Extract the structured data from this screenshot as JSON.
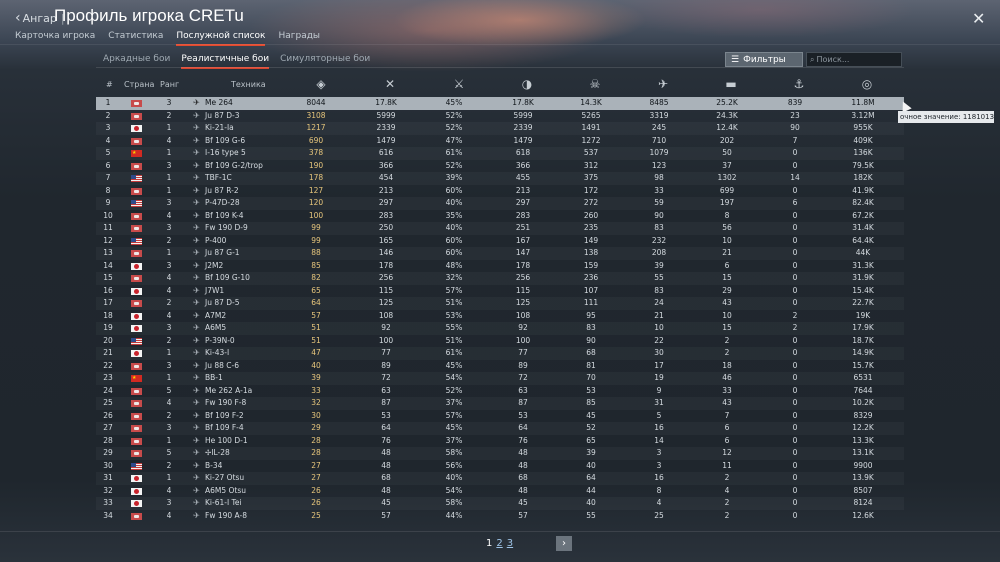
{
  "header": {
    "back_label": "Ангар",
    "title": "Профиль игрока CRETu",
    "tabs": [
      {
        "label": "Карточка игрока"
      },
      {
        "label": "Статистика"
      },
      {
        "label": "Послужной список"
      },
      {
        "label": "Награды"
      }
    ],
    "close_icon": "close-icon"
  },
  "modes": [
    {
      "label": "Аркадные бои"
    },
    {
      "label": "Реалистичные бои"
    },
    {
      "label": "Симуляторные бои"
    }
  ],
  "filter": {
    "label": "Фильтры",
    "icon": "sliders-icon"
  },
  "search": {
    "placeholder": "Поиск..."
  },
  "table": {
    "headers": {
      "idx": "#",
      "country": "Страна",
      "rank": "Ранг",
      "vehicle": "Техника"
    },
    "icon_headers": [
      "score-icon",
      "battles-icon",
      "victories-percent-icon",
      "respawns-icon",
      "deaths-icon",
      "air-kills-icon",
      "ground-kills-icon",
      "naval-kills-icon",
      "experience-icon"
    ],
    "rows": [
      {
        "idx": "1",
        "flag": "gb",
        "rank": "3",
        "name": "Me 264",
        "score": "8044",
        "v": [
          "17.8K",
          "45%",
          "17.8K",
          "14.3K",
          "8485",
          "25.2K",
          "839",
          "11.8M"
        ]
      },
      {
        "idx": "2",
        "flag": "gb",
        "rank": "2",
        "name": "Ju 87 D-3",
        "score": "3108",
        "v": [
          "5999",
          "52%",
          "5999",
          "5265",
          "3319",
          "24.3K",
          "23",
          "3.12M"
        ]
      },
      {
        "idx": "3",
        "flag": "jp",
        "rank": "1",
        "name": "Ki-21-Ia",
        "score": "1217",
        "v": [
          "2339",
          "52%",
          "2339",
          "1491",
          "245",
          "12.4K",
          "90",
          "955K"
        ]
      },
      {
        "idx": "4",
        "flag": "gb",
        "rank": "4",
        "name": "Bf 109 G-6",
        "score": "690",
        "v": [
          "1479",
          "47%",
          "1479",
          "1272",
          "710",
          "202",
          "7",
          "409K"
        ]
      },
      {
        "idx": "5",
        "flag": "cn",
        "rank": "1",
        "name": "I-16 type 5",
        "score": "378",
        "v": [
          "616",
          "61%",
          "618",
          "537",
          "1079",
          "50",
          "0",
          "136K"
        ]
      },
      {
        "idx": "6",
        "flag": "gb",
        "rank": "3",
        "name": "Bf 109 G-2/trop",
        "score": "190",
        "v": [
          "366",
          "52%",
          "366",
          "312",
          "123",
          "37",
          "0",
          "79.5K"
        ]
      },
      {
        "idx": "7",
        "flag": "us",
        "rank": "1",
        "name": "TBF-1C",
        "score": "178",
        "v": [
          "454",
          "39%",
          "455",
          "375",
          "98",
          "1302",
          "14",
          "182K"
        ]
      },
      {
        "idx": "8",
        "flag": "gb",
        "rank": "1",
        "name": "Ju 87 R-2",
        "score": "127",
        "v": [
          "213",
          "60%",
          "213",
          "172",
          "33",
          "699",
          "0",
          "41.9K"
        ]
      },
      {
        "idx": "9",
        "flag": "us",
        "rank": "3",
        "name": "P-47D-28",
        "score": "120",
        "v": [
          "297",
          "40%",
          "297",
          "272",
          "59",
          "197",
          "6",
          "82.4K"
        ]
      },
      {
        "idx": "10",
        "flag": "gb",
        "rank": "4",
        "name": "Bf 109 K-4",
        "score": "100",
        "v": [
          "283",
          "35%",
          "283",
          "260",
          "90",
          "8",
          "0",
          "67.2K"
        ]
      },
      {
        "idx": "11",
        "flag": "gb",
        "rank": "3",
        "name": "Fw 190 D-9",
        "score": "99",
        "v": [
          "250",
          "40%",
          "251",
          "235",
          "83",
          "56",
          "0",
          "31.4K"
        ]
      },
      {
        "idx": "12",
        "flag": "us",
        "rank": "2",
        "name": "P-400",
        "score": "99",
        "v": [
          "165",
          "60%",
          "167",
          "149",
          "232",
          "10",
          "0",
          "64.4K"
        ]
      },
      {
        "idx": "13",
        "flag": "gb",
        "rank": "1",
        "name": "Ju 87 G-1",
        "score": "88",
        "v": [
          "146",
          "60%",
          "147",
          "138",
          "208",
          "21",
          "0",
          "44K"
        ]
      },
      {
        "idx": "14",
        "flag": "jp",
        "rank": "3",
        "name": "J2M2",
        "score": "85",
        "v": [
          "178",
          "48%",
          "178",
          "159",
          "39",
          "6",
          "0",
          "31.3K"
        ]
      },
      {
        "idx": "15",
        "flag": "gb",
        "rank": "4",
        "name": "Bf 109 G-10",
        "score": "82",
        "v": [
          "256",
          "32%",
          "256",
          "236",
          "55",
          "15",
          "0",
          "31.9K"
        ]
      },
      {
        "idx": "16",
        "flag": "jp",
        "rank": "4",
        "name": "J7W1",
        "score": "65",
        "v": [
          "115",
          "57%",
          "115",
          "107",
          "83",
          "29",
          "0",
          "15.4K"
        ]
      },
      {
        "idx": "17",
        "flag": "gb",
        "rank": "2",
        "name": "Ju 87 D-5",
        "score": "64",
        "v": [
          "125",
          "51%",
          "125",
          "111",
          "24",
          "43",
          "0",
          "22.7K"
        ]
      },
      {
        "idx": "18",
        "flag": "jp",
        "rank": "4",
        "name": "A7M2",
        "score": "57",
        "v": [
          "108",
          "53%",
          "108",
          "95",
          "21",
          "10",
          "2",
          "19K"
        ]
      },
      {
        "idx": "19",
        "flag": "jp",
        "rank": "3",
        "name": "A6M5",
        "score": "51",
        "v": [
          "92",
          "55%",
          "92",
          "83",
          "10",
          "15",
          "2",
          "17.9K"
        ]
      },
      {
        "idx": "20",
        "flag": "us",
        "rank": "2",
        "name": "P-39N-0",
        "score": "51",
        "v": [
          "100",
          "51%",
          "100",
          "90",
          "22",
          "2",
          "0",
          "18.7K"
        ]
      },
      {
        "idx": "21",
        "flag": "jp",
        "rank": "1",
        "name": "Ki-43-I",
        "score": "47",
        "v": [
          "77",
          "61%",
          "77",
          "68",
          "30",
          "2",
          "0",
          "14.9K"
        ]
      },
      {
        "idx": "22",
        "flag": "gb",
        "rank": "3",
        "name": "Ju 88 C-6",
        "score": "40",
        "v": [
          "89",
          "45%",
          "89",
          "81",
          "17",
          "18",
          "0",
          "15.7K"
        ]
      },
      {
        "idx": "23",
        "flag": "cn",
        "rank": "1",
        "name": "BB-1",
        "score": "39",
        "v": [
          "72",
          "54%",
          "72",
          "70",
          "19",
          "46",
          "0",
          "6531"
        ]
      },
      {
        "idx": "24",
        "flag": "gb",
        "rank": "5",
        "name": "Me 262 A-1a",
        "score": "33",
        "v": [
          "63",
          "52%",
          "63",
          "53",
          "9",
          "33",
          "0",
          "7644"
        ]
      },
      {
        "idx": "25",
        "flag": "gb",
        "rank": "4",
        "name": "Fw 190 F-8",
        "score": "32",
        "v": [
          "87",
          "37%",
          "87",
          "85",
          "31",
          "43",
          "0",
          "10.2K"
        ]
      },
      {
        "idx": "26",
        "flag": "gb",
        "rank": "2",
        "name": "Bf 109 F-2",
        "score": "30",
        "v": [
          "53",
          "57%",
          "53",
          "45",
          "5",
          "7",
          "0",
          "8329"
        ]
      },
      {
        "idx": "27",
        "flag": "gb",
        "rank": "3",
        "name": "Bf 109 F-4",
        "score": "29",
        "v": [
          "64",
          "45%",
          "64",
          "52",
          "16",
          "6",
          "0",
          "12.2K"
        ]
      },
      {
        "idx": "28",
        "flag": "gb",
        "rank": "1",
        "name": "He 100 D-1",
        "score": "28",
        "v": [
          "76",
          "37%",
          "76",
          "65",
          "14",
          "6",
          "0",
          "13.3K"
        ]
      },
      {
        "idx": "29",
        "flag": "gb",
        "rank": "5",
        "name": "✢IL-28",
        "score": "28",
        "v": [
          "48",
          "58%",
          "48",
          "39",
          "3",
          "12",
          "0",
          "13.1K"
        ]
      },
      {
        "idx": "30",
        "flag": "us",
        "rank": "2",
        "name": "B-34",
        "score": "27",
        "v": [
          "48",
          "56%",
          "48",
          "40",
          "3",
          "11",
          "0",
          "9900"
        ]
      },
      {
        "idx": "31",
        "flag": "jp",
        "rank": "1",
        "name": "Ki-27 Otsu",
        "score": "27",
        "v": [
          "68",
          "40%",
          "68",
          "64",
          "16",
          "2",
          "0",
          "13.9K"
        ]
      },
      {
        "idx": "32",
        "flag": "jp",
        "rank": "4",
        "name": "A6M5 Otsu",
        "score": "26",
        "v": [
          "48",
          "54%",
          "48",
          "44",
          "8",
          "4",
          "0",
          "8507"
        ]
      },
      {
        "idx": "33",
        "flag": "jp",
        "rank": "3",
        "name": "Ki-61-I Tei",
        "score": "26",
        "v": [
          "45",
          "58%",
          "45",
          "40",
          "4",
          "2",
          "0",
          "8124"
        ]
      },
      {
        "idx": "34",
        "flag": "gb",
        "rank": "4",
        "name": "Fw 190 A-8",
        "score": "25",
        "v": [
          "57",
          "44%",
          "57",
          "55",
          "25",
          "2",
          "0",
          "12.6K"
        ]
      }
    ]
  },
  "tooltip": {
    "text": "очное значение: 11810133"
  },
  "pager": {
    "pages": [
      "1",
      "2",
      "3"
    ],
    "current": "1"
  }
}
